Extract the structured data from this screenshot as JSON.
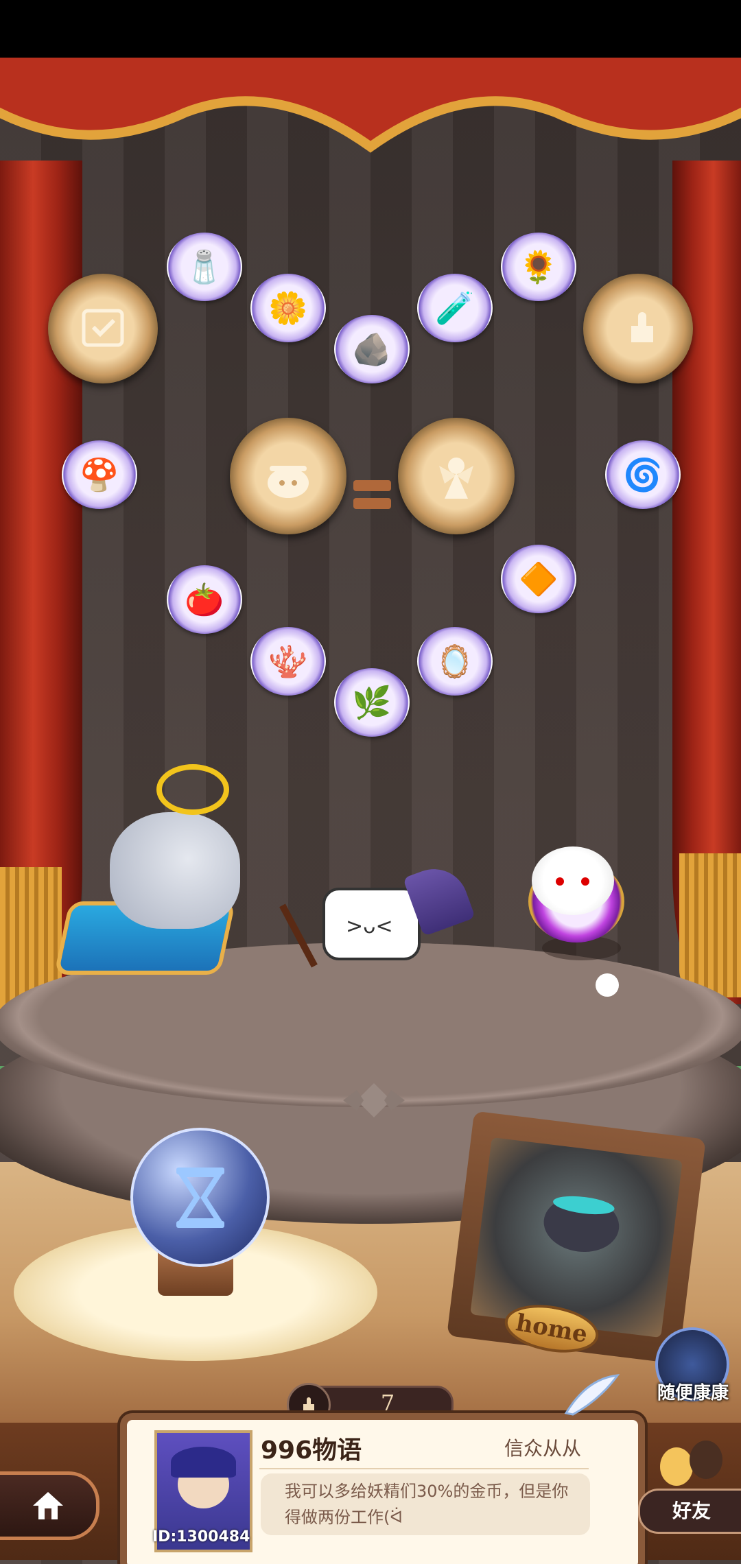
{
  "screen": {
    "name": "theater-stage"
  },
  "badges": [
    {
      "id": "rule-badge",
      "icon": "scroll-check-icon"
    },
    {
      "id": "like-badge",
      "icon": "thumbs-up-flower-icon"
    },
    {
      "id": "cauldron-badge",
      "icon": "cauldron-icon"
    },
    {
      "id": "fairy-badge",
      "icon": "fairy-icon"
    }
  ],
  "equals_sign": "=",
  "ingredients": [
    {
      "name": "salt-crystals",
      "glyph": "🧂"
    },
    {
      "name": "white-lily",
      "glyph": "🌼"
    },
    {
      "name": "white-stones",
      "glyph": "🪨"
    },
    {
      "name": "teal-potion",
      "glyph": "🧪"
    },
    {
      "name": "yellow-flower",
      "glyph": "🌻"
    },
    {
      "name": "purple-mushroom",
      "glyph": "🍄"
    },
    {
      "name": "blue-pinwheel",
      "glyph": "🌀"
    },
    {
      "name": "red-tomato",
      "glyph": "🍅"
    },
    {
      "name": "red-coral",
      "glyph": "🪸"
    },
    {
      "name": "green-herb",
      "glyph": "🌿"
    },
    {
      "name": "mirror",
      "glyph": "🪞"
    },
    {
      "name": "amber-gem",
      "glyph": "🔶"
    }
  ],
  "home_sign": "home",
  "likes": {
    "count": "7"
  },
  "random_visit": {
    "label": "随便康康"
  },
  "profile": {
    "id_label": "ID:1300484",
    "name": "996物语",
    "title": "信众从从",
    "quote": "我可以多给妖精们30%的金币，但是你得做两份工作(ᐛ"
  },
  "friends": {
    "label": "好友"
  },
  "colors": {
    "curtain": "#c43a25",
    "fringe": "#e2a33b",
    "panel": "#fff8ea",
    "panel_border": "#8a5a3a"
  }
}
